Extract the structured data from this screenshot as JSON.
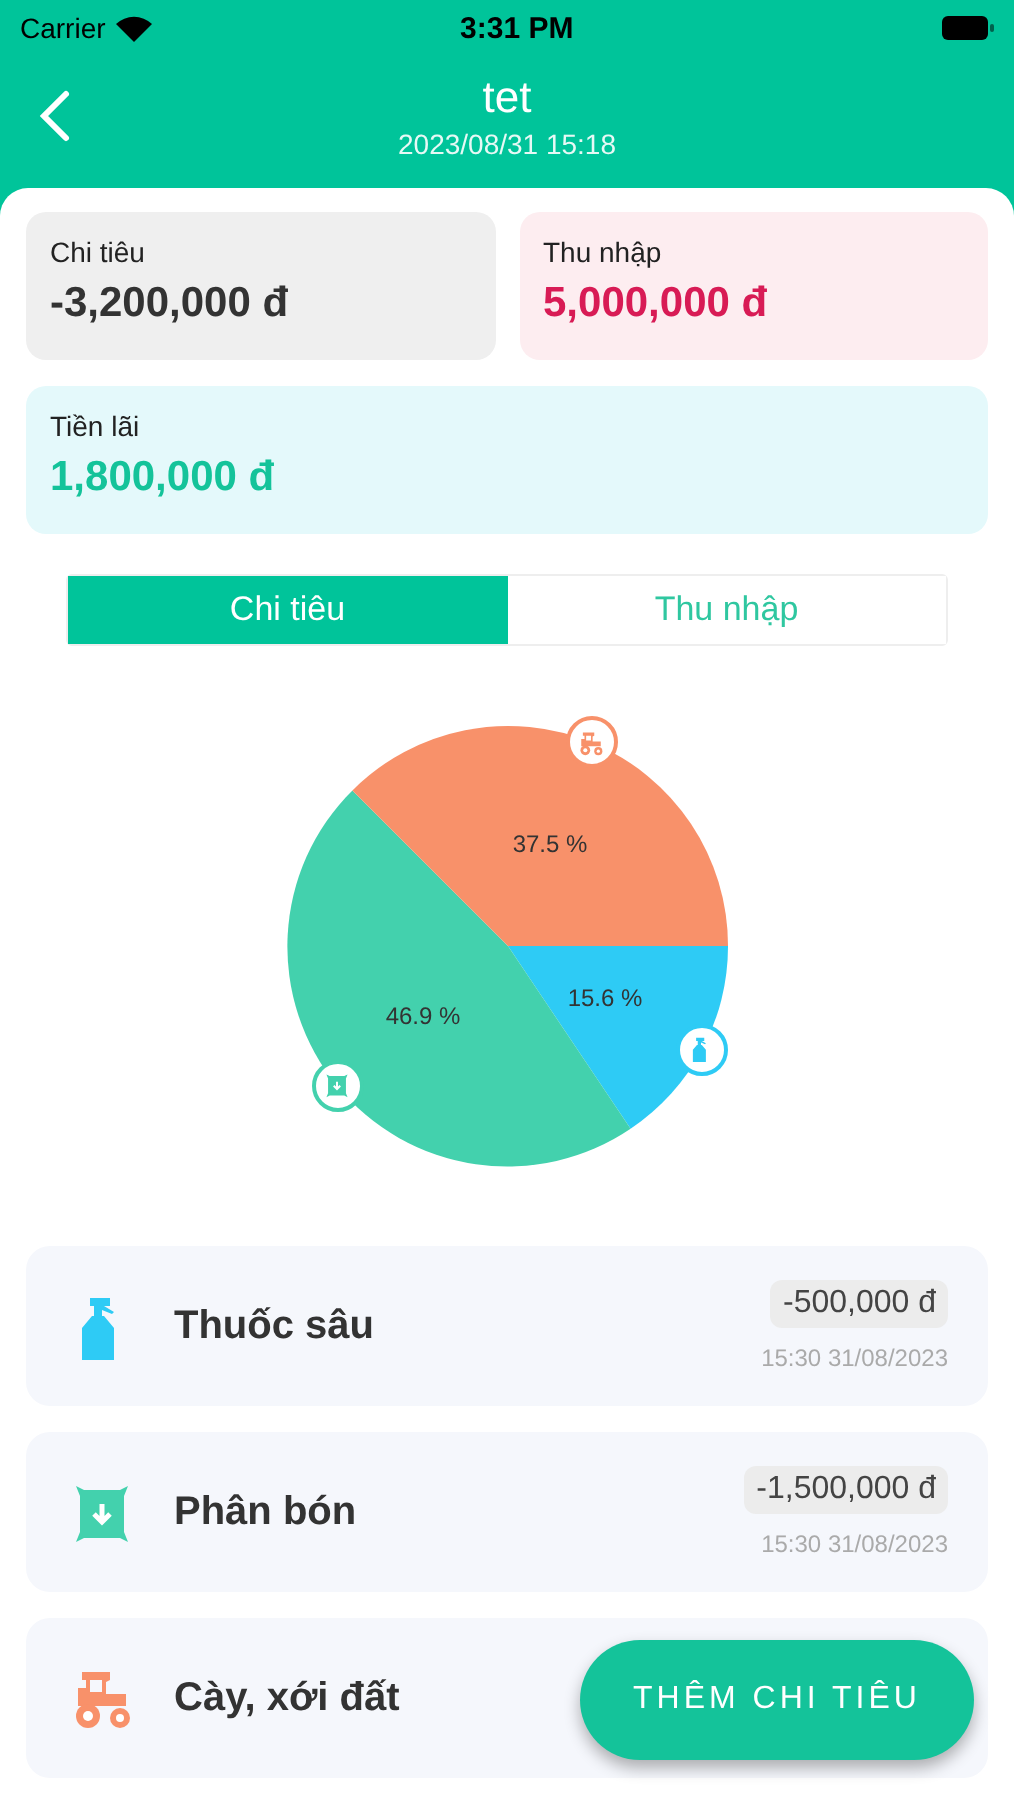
{
  "status_bar": {
    "carrier": "Carrier",
    "time": "3:31 PM"
  },
  "header": {
    "title": "tet",
    "subtitle": "2023/08/31 15:18"
  },
  "summary": [
    {
      "kind": "expense",
      "label": "Chi tiêu",
      "amount": "-3,200,000 đ"
    },
    {
      "kind": "income",
      "label": "Thu nhập",
      "amount": "5,000,000 đ"
    },
    {
      "kind": "profit",
      "label": "Tiền lãi",
      "amount": "1,800,000 đ"
    }
  ],
  "tabs": [
    {
      "label": "Chi tiêu",
      "selected": true
    },
    {
      "label": "Thu nhập",
      "selected": false
    }
  ],
  "chart": {
    "chart_data": {
      "type": "pie",
      "values": [
        15.6,
        46.9,
        37.5
      ],
      "colors": [
        "#2ecbf5",
        "#43d1ad",
        "#f8916a"
      ],
      "value_labels": [
        "15.6 %",
        "46.9 %",
        "37.5 %"
      ]
    }
  },
  "items": [
    {
      "kind": "pesticide",
      "name": "Thuốc sâu",
      "amount": "-500,000 đ",
      "time": "15:30 31/08/2023"
    },
    {
      "kind": "fertilizer",
      "name": "Phân bón",
      "amount": "-1,500,000 đ",
      "time": "15:30 31/08/2023"
    },
    {
      "kind": "tillage",
      "name": "Cày, xới đất"
    }
  ],
  "fab": {
    "label": "THÊM CHI TIÊU"
  }
}
